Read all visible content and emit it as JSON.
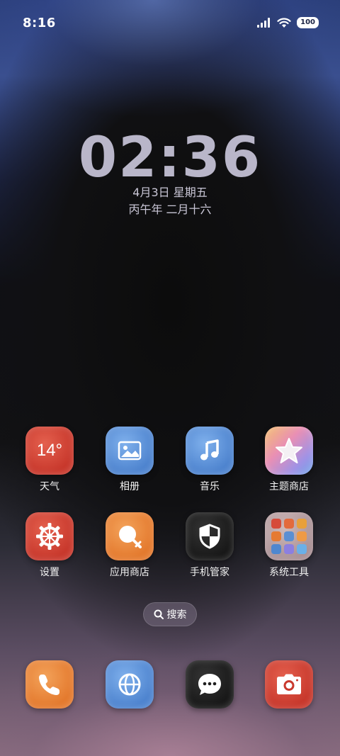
{
  "status_bar": {
    "time": "8:16",
    "battery": "100",
    "icons": [
      "signal-icon",
      "wifi-icon",
      "battery-icon"
    ]
  },
  "lockclock": {
    "time": "02:36",
    "date": "4月3日 星期五",
    "lunar": "丙午年 二月十六"
  },
  "apps": [
    {
      "label": "天气",
      "icon": "weather-icon",
      "badge": "14°",
      "color": "#d04a3a"
    },
    {
      "label": "相册",
      "icon": "gallery-icon",
      "color": "#5a8fd6"
    },
    {
      "label": "音乐",
      "icon": "music-note-icon",
      "color": "#5a8fd6"
    },
    {
      "label": "主题商店",
      "icon": "star-icon",
      "color": "#e9a6c0"
    },
    {
      "label": "设置",
      "icon": "gear-icon",
      "color": "#d04a3a"
    },
    {
      "label": "应用商店",
      "icon": "app-store-icon",
      "color": "#e8842f"
    },
    {
      "label": "手机管家",
      "icon": "shield-icon",
      "color": "#1e1e1e"
    },
    {
      "label": "系统工具",
      "icon": "folder-icon",
      "color": "#bda4a8"
    }
  ],
  "search": {
    "label": "搜索",
    "icon": "search-icon"
  },
  "dock": [
    {
      "name": "phone",
      "icon": "phone-icon",
      "color": "#e8842f"
    },
    {
      "name": "browser",
      "icon": "globe-icon",
      "color": "#5a8fd6"
    },
    {
      "name": "messages",
      "icon": "chat-bubble-icon",
      "color": "#1e1e1e"
    },
    {
      "name": "camera",
      "icon": "camera-icon",
      "color": "#d04a3a"
    }
  ]
}
